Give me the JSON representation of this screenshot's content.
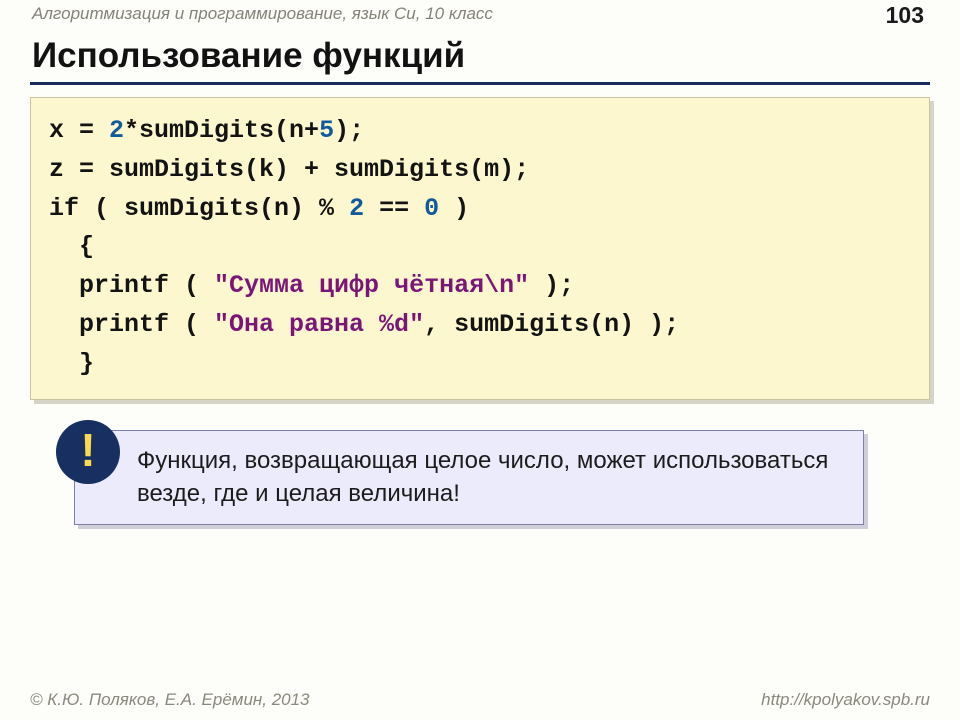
{
  "header": {
    "breadcrumb": "Алгоритмизация и программирование, язык Си, 10 класс",
    "page_number": "103"
  },
  "title": "Использование функций",
  "code": {
    "l1a": "x = ",
    "l1n1": "2",
    "l1b": "*sumDigits(n+",
    "l1n2": "5",
    "l1c": ");",
    "l2": "z = sumDigits(k) + sumDigits(m);",
    "l3a": "if ( sumDigits(n) % ",
    "l3n1": "2",
    "l3b": " == ",
    "l3n2": "0",
    "l3c": " )",
    "l4": "  {",
    "l5a": "  printf ( ",
    "l5s": "\"Сумма цифр чётная\\n\"",
    "l5b": " );",
    "l6a": "  printf ( ",
    "l6s": "\"Она равна %d\"",
    "l6b": ", sumDigits(n) );",
    "l7": "  }"
  },
  "note": {
    "bang": "!",
    "text": "Функция, возвращающая целое число, может использоваться везде, где и целая величина!"
  },
  "footer": {
    "left": "© К.Ю. Поляков, Е.А. Ерёмин, 2013",
    "right": "http://kpolyakov.spb.ru"
  }
}
